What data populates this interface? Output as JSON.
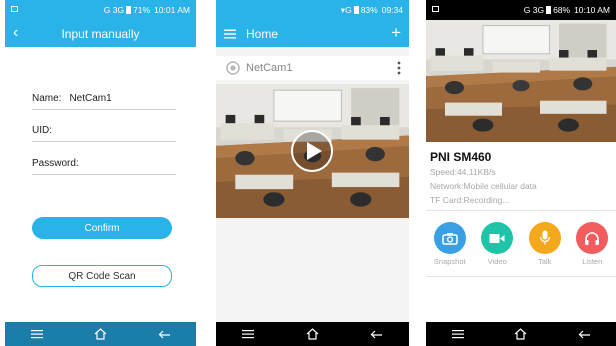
{
  "phone1": {
    "status_time": "10:01 AM",
    "status_battery": "71%",
    "status_network": "G 3G",
    "title": "Input manually",
    "name_label": "Name:",
    "name_value": "NetCam1",
    "uid_label": "UID:",
    "uid_value": "",
    "password_label": "Password:",
    "password_value": "",
    "confirm_label": "Confirm",
    "qr_label": "QR Code Scan"
  },
  "phone2": {
    "status_time": "09:34",
    "status_battery": "83%",
    "status_network": "G",
    "title": "Home",
    "camera_name": "NetCam1"
  },
  "phone3": {
    "status_time": "10:10 AM",
    "status_battery": "68%",
    "status_network": "G 3G",
    "camera_title": "PNI SM460",
    "speed": "Speed:44.11KB/s",
    "network": "Network:Mobile cellular data",
    "tfcard": "TF Card:Recording...",
    "actions": [
      {
        "label": "Snapshot",
        "color": "#3aa0e3",
        "icon": "camera-icon"
      },
      {
        "label": "Video",
        "color": "#1fc4a8",
        "icon": "video-icon"
      },
      {
        "label": "Talk",
        "color": "#f4a81b",
        "icon": "microphone-icon"
      },
      {
        "label": "Listen",
        "color": "#f25c5c",
        "icon": "headphones-icon"
      }
    ]
  },
  "colors": {
    "accent": "#29b3e8",
    "nav_dark": "#1b7ea8"
  }
}
